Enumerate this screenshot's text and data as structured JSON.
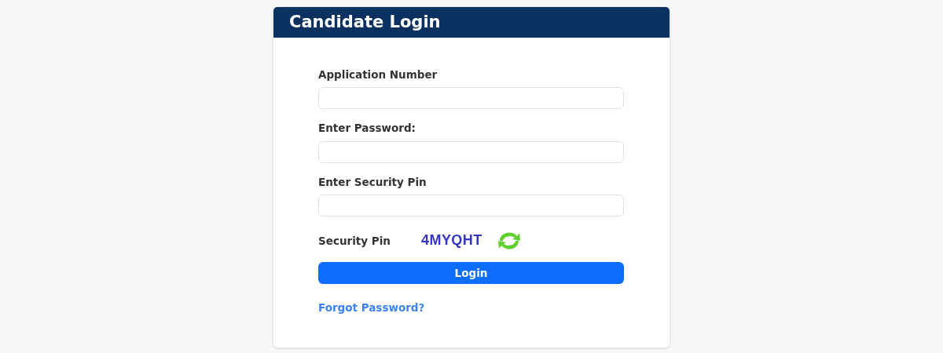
{
  "card": {
    "title": "Candidate Login"
  },
  "fields": [
    {
      "label": "Application Number"
    },
    {
      "label": "Enter Password:"
    },
    {
      "label": "Enter Security Pin"
    }
  ],
  "captcha": {
    "label": "Security Pin",
    "code": "4MYQHT"
  },
  "login_button": "Login",
  "forgot_link": "Forgot Password?"
}
